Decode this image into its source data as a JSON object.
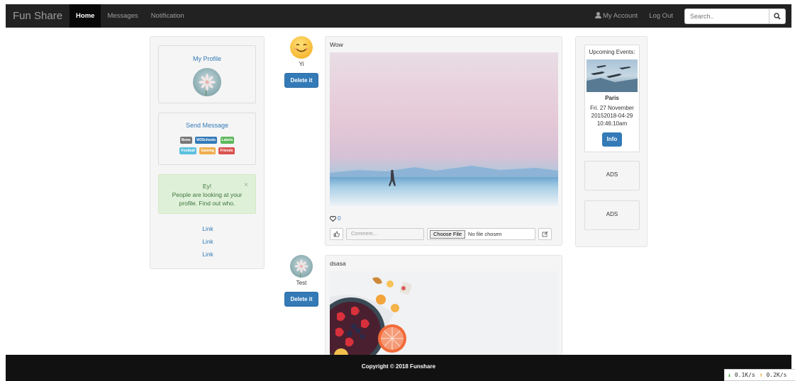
{
  "navbar": {
    "brand": "Fun Share",
    "links": [
      "Home",
      "Messages",
      "Notification"
    ],
    "account": "My Account",
    "logout": "Log Out",
    "search_placeholder": "Search.."
  },
  "left_sidebar": {
    "profile_title": "My Profile",
    "message_title": "Send Message",
    "tags": [
      {
        "label": "News",
        "color": "#777777"
      },
      {
        "label": "W3Schools",
        "color": "#337ab7"
      },
      {
        "label": "Labels",
        "color": "#5cb85c"
      },
      {
        "label": "Football",
        "color": "#5bc0de"
      },
      {
        "label": "Gaming",
        "color": "#f0ad4e"
      },
      {
        "label": "Friends",
        "color": "#d9534f"
      }
    ],
    "alert_title": "Ey!",
    "alert_text": "People are looking at your profile. Find out who.",
    "alert_close": "×",
    "links": [
      "Link",
      "Link",
      "Link"
    ]
  },
  "posts": [
    {
      "author": "Yi",
      "delete_label": "Delete it",
      "text": "Wow",
      "likes": "0",
      "comment_placeholder": "Comment...",
      "choose_file": "Choose File",
      "no_file": "No file chosen"
    },
    {
      "author": "Test",
      "delete_label": "Delete it",
      "text": "dsasa"
    }
  ],
  "right_sidebar": {
    "event_title": "Upcoming Events:",
    "event_city": "Paris",
    "event_date": "Fri. 27 November 20152018-04-29 10:46:10am",
    "info_label": "Info",
    "ads": [
      "ADS",
      "ADS"
    ]
  },
  "footer": {
    "copyright": "Copyright © 2018 Funshare"
  },
  "network": {
    "down": "0.1K/s",
    "up": "0.2K/s"
  },
  "colors": {
    "primary": "#337ab7",
    "navbar": "#222222",
    "footer": "#111111",
    "alert_bg": "#dff0d8"
  }
}
